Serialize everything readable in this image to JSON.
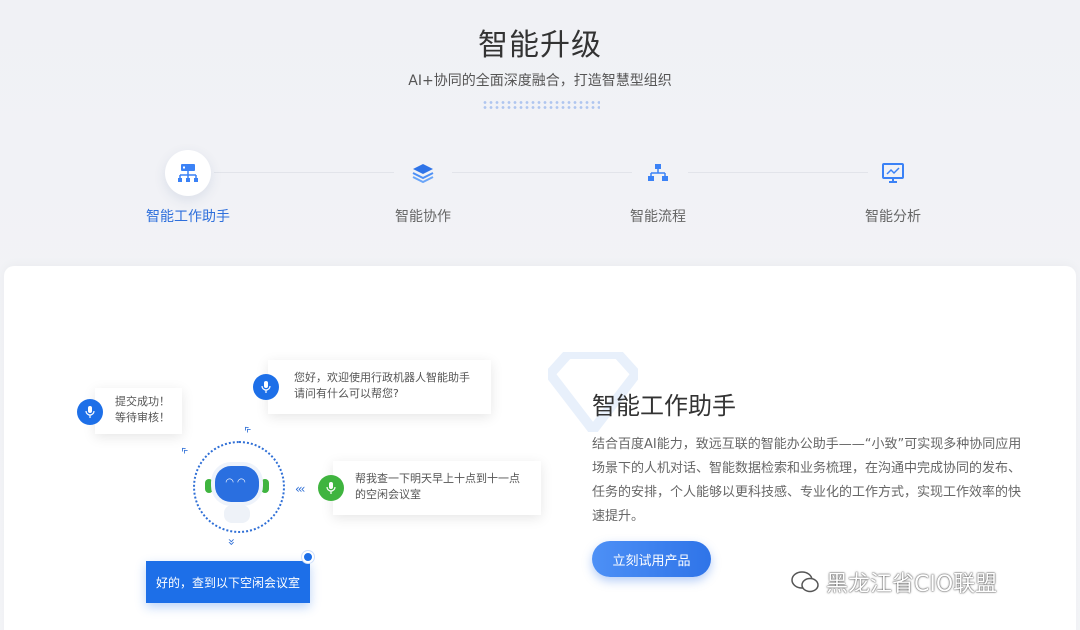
{
  "hero": {
    "title": "智能升级",
    "subtitle": "AI+协同的全面深度融合，打造智慧型组织"
  },
  "tabs": [
    {
      "label": "智能工作助手",
      "icon": "network-icon",
      "active": true
    },
    {
      "label": "智能协作",
      "icon": "layers-icon",
      "active": false
    },
    {
      "label": "智能流程",
      "icon": "flowchart-icon",
      "active": false
    },
    {
      "label": "智能分析",
      "icon": "monitor-icon",
      "active": false
    }
  ],
  "chat": {
    "submit_msg_line1": "提交成功！",
    "submit_msg_line2": "等待审核！",
    "welcome_line1": "您好，欢迎使用行政机器人智能助手",
    "welcome_line2": "请问有什么可以帮您?",
    "query_line1": "帮我查一下明天早上十点到十一点",
    "query_line2": "的空闲会议室",
    "reply": "好的，查到以下空闲会议室"
  },
  "feature": {
    "title": "智能工作助手",
    "description": "结合百度AI能力，致远互联的智能办公助手——“小致”可实现多种协同应用场景下的人机对话、智能数据检索和业务梳理，在沟通中完成协同的发布、任务的安排，个人能够以更科技感、专业化的工作方式，实现工作效率的快速提升。",
    "button_label": "立刻试用产品"
  },
  "watermark": "黑龙江省CIO联盟",
  "colors": {
    "accent": "#2e6fdc",
    "mic_blue": "#1d6fe8",
    "mic_green": "#3fb43f"
  }
}
